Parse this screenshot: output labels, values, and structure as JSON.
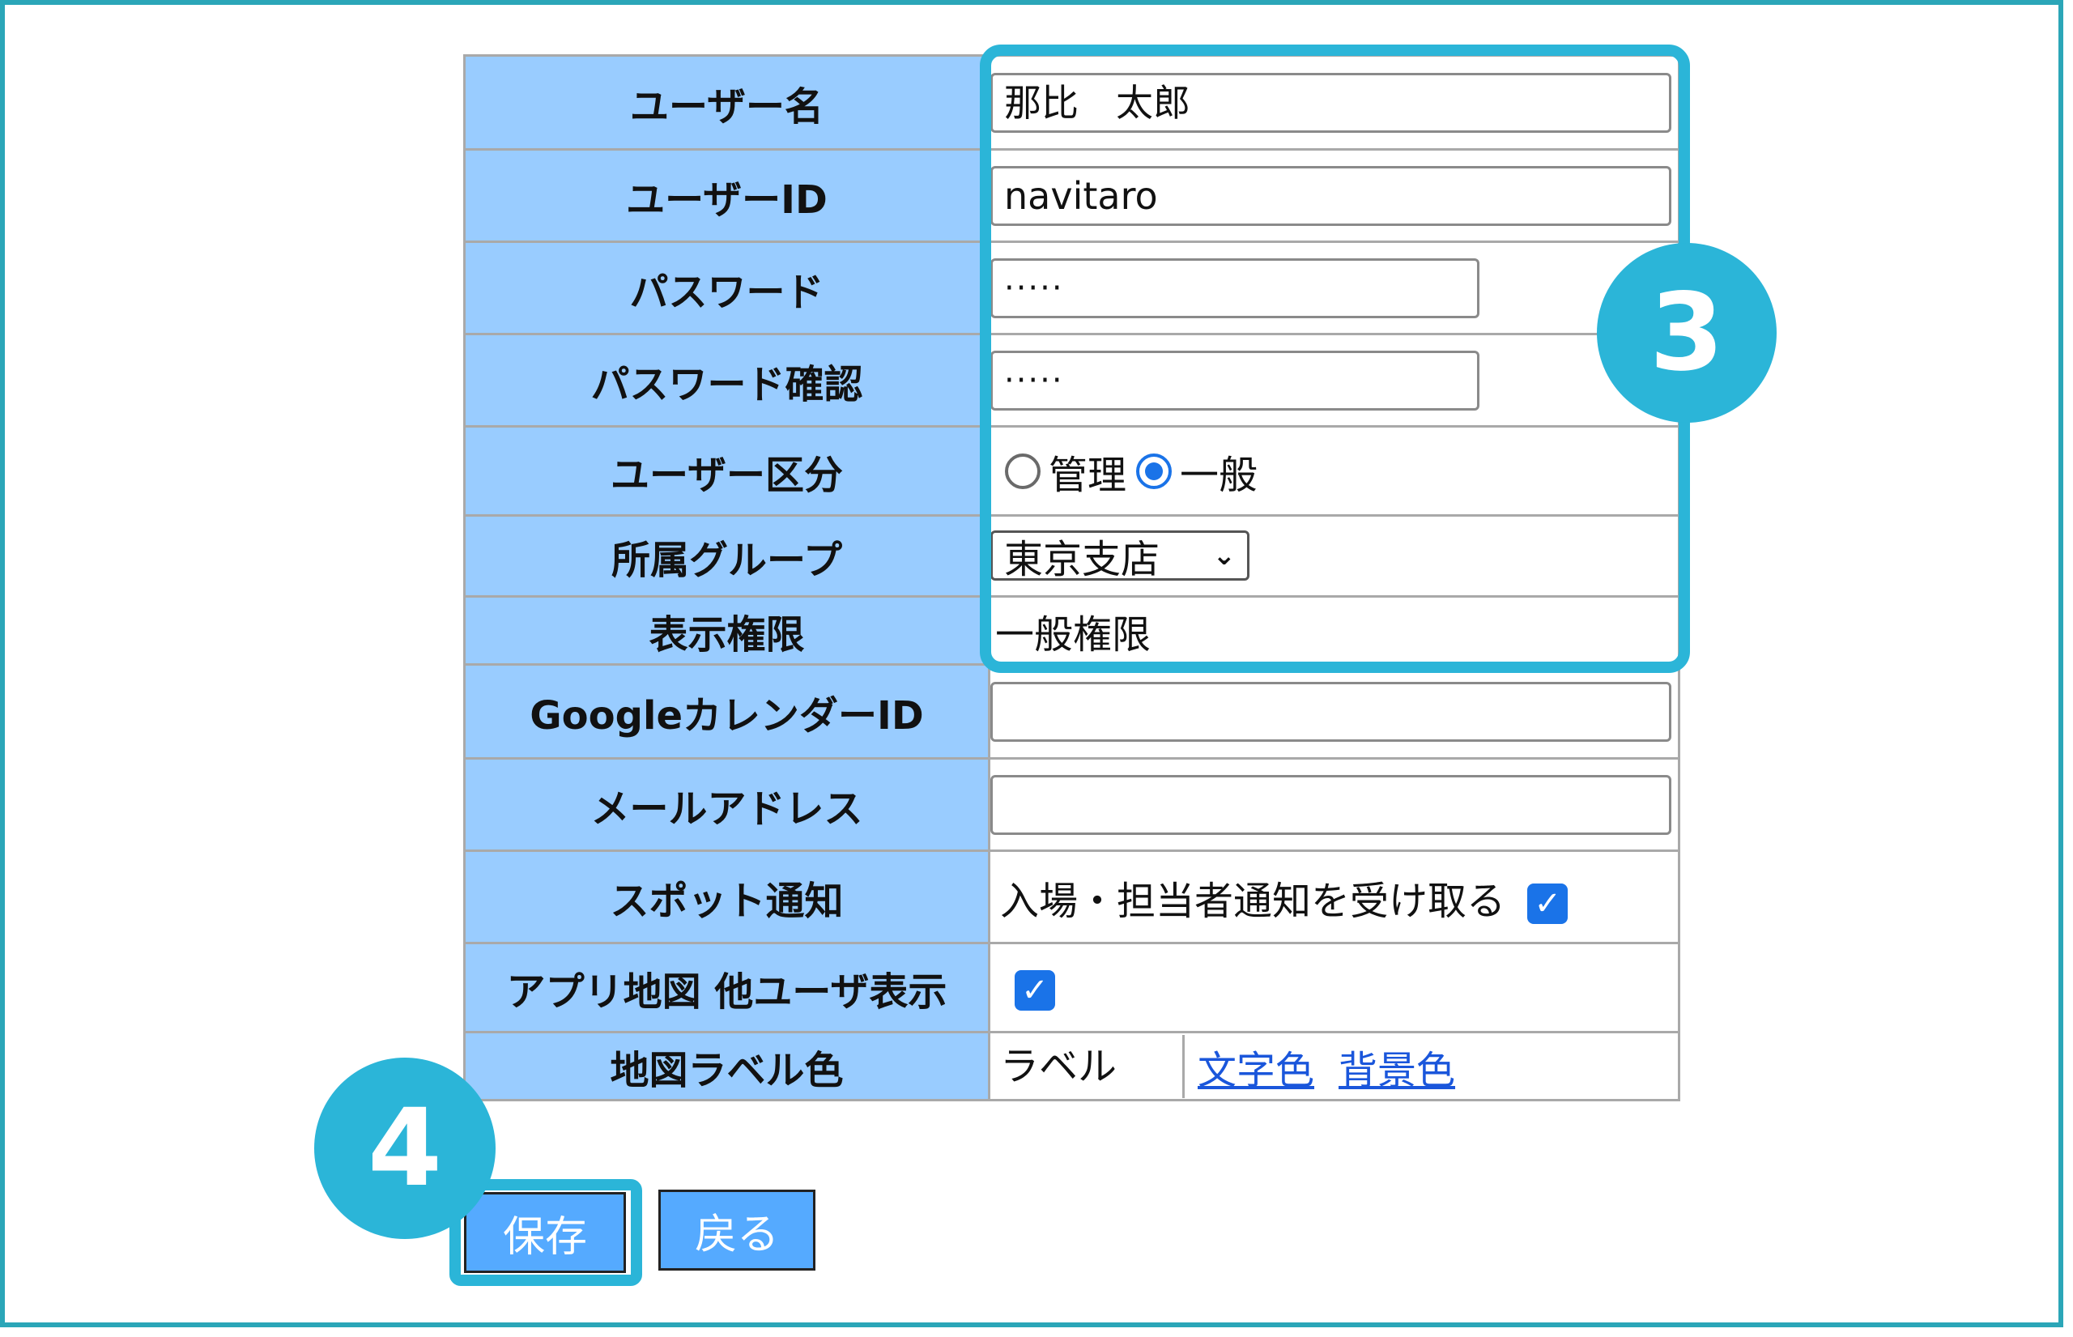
{
  "form": {
    "rows": {
      "username": {
        "label": "ユーザー名",
        "value": "那比　太郎"
      },
      "userid": {
        "label": "ユーザーID",
        "value": "navitaro"
      },
      "password": {
        "label": "パスワード",
        "value": "·····"
      },
      "password_confirm": {
        "label": "パスワード確認",
        "value": "·····"
      },
      "user_type": {
        "label": "ユーザー区分",
        "options": [
          "管理",
          "一般"
        ],
        "selected": "一般"
      },
      "group": {
        "label": "所属グループ",
        "value": "東京支店"
      },
      "view_permission": {
        "label": "表示権限",
        "value": "一般権限"
      },
      "google_calendar": {
        "label": "GoogleカレンダーID",
        "value": ""
      },
      "email": {
        "label": "メールアドレス",
        "value": ""
      },
      "spot_notify": {
        "label": "スポット通知",
        "checkbox_label": "入場・担当者通知を受け取る",
        "checked": true
      },
      "app_map": {
        "label": "アプリ地図 他ユーザ表示",
        "checked": true
      },
      "map_label_color": {
        "label": "地図ラベル色",
        "value": "ラベル",
        "links": [
          "文字色",
          "背景色"
        ]
      }
    }
  },
  "buttons": {
    "save": "保存",
    "back": "戻る"
  },
  "badges": {
    "step3": "3",
    "step4": "4"
  },
  "colors": {
    "label_bg": "#99ccff",
    "highlight": "#2bb5d8",
    "button_bg": "#55aaff",
    "frame": "#2ba6b8"
  }
}
